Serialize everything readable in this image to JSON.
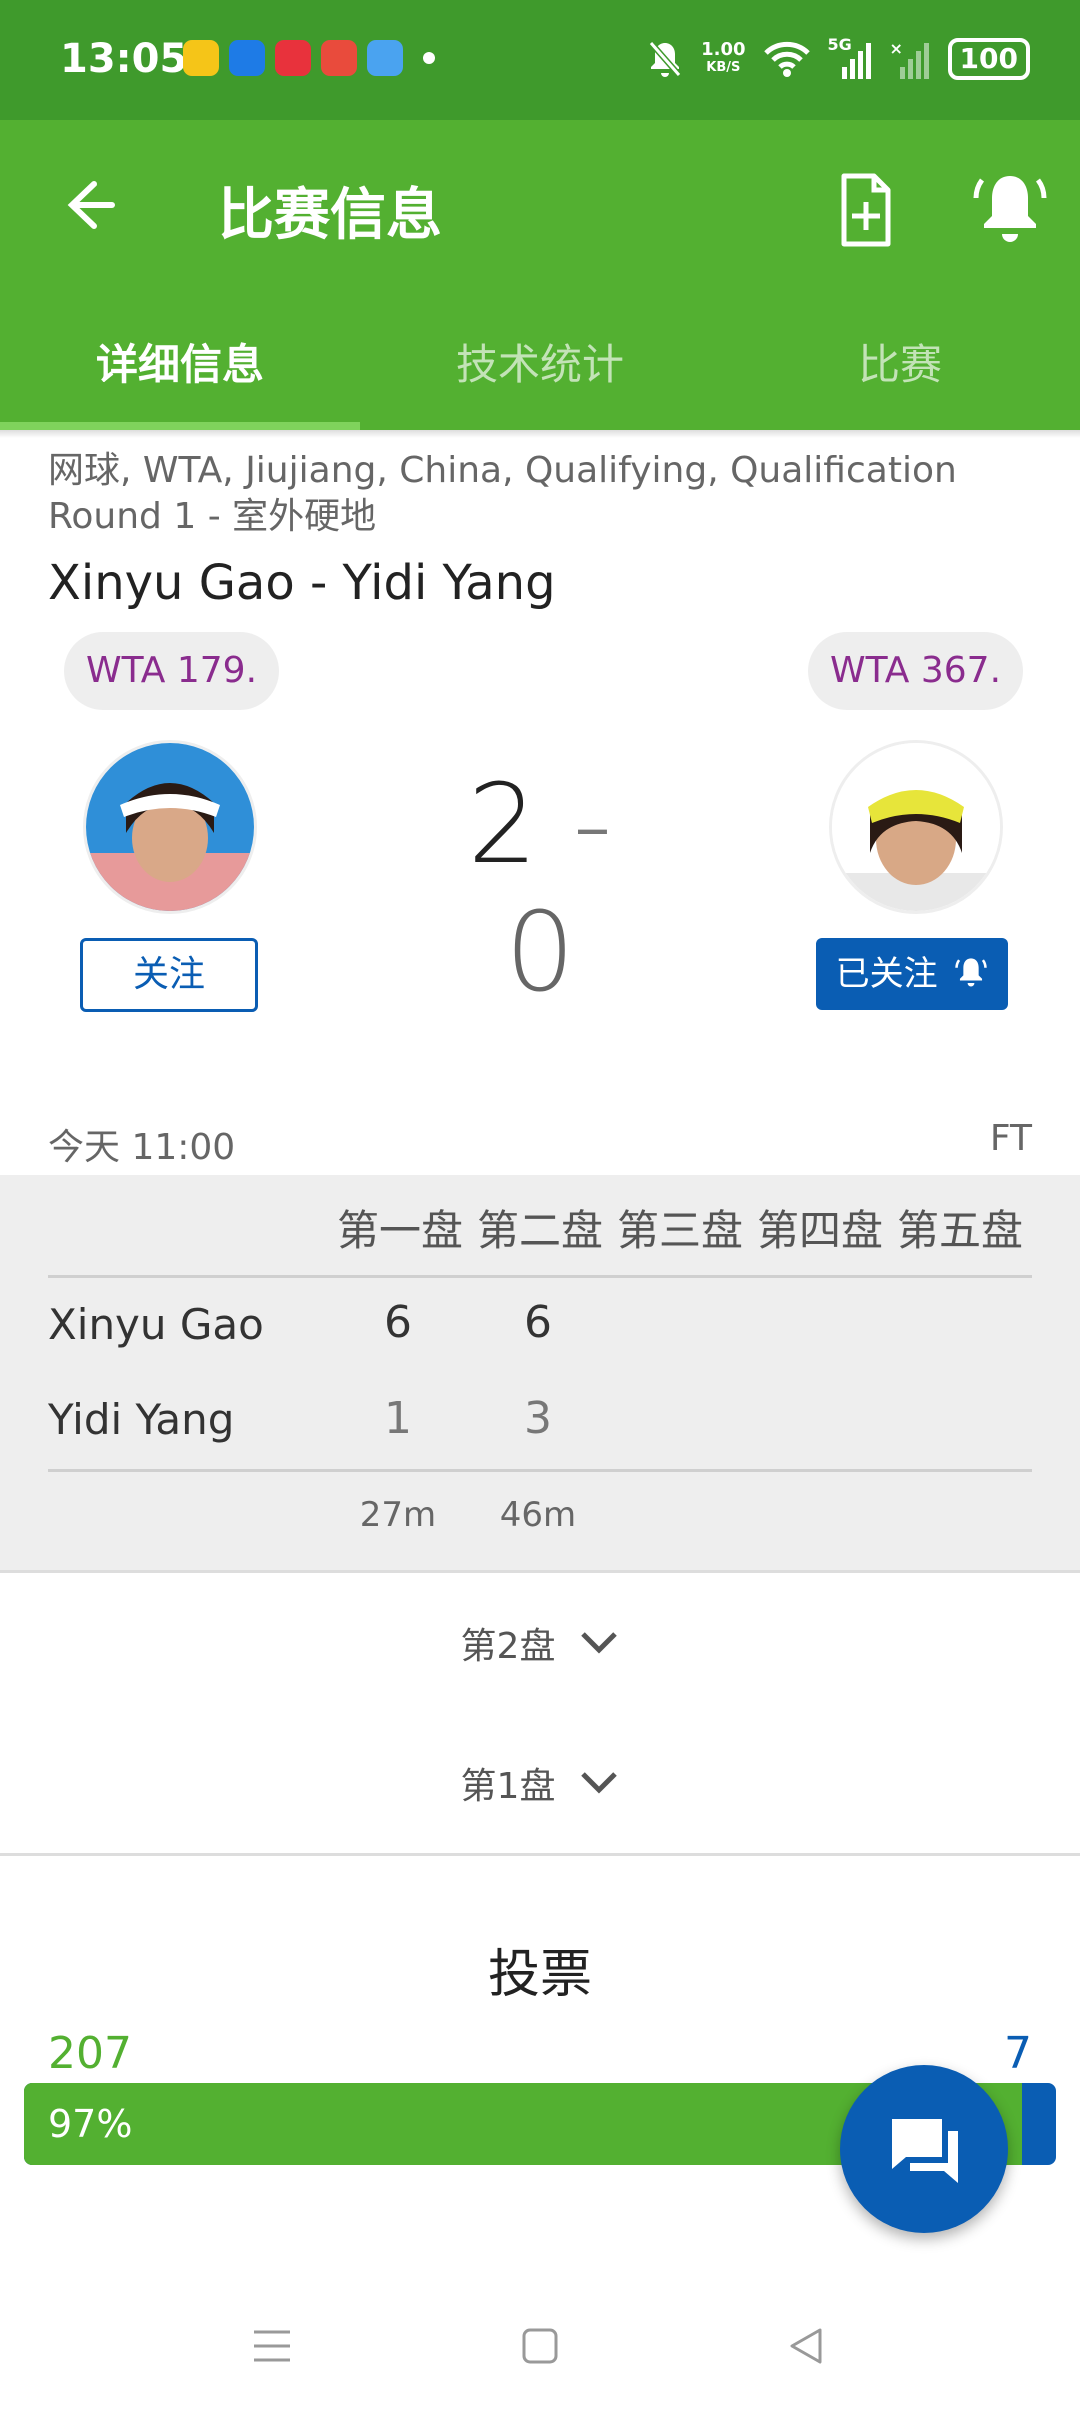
{
  "status_bar": {
    "time": "13:05",
    "network_speed_value": "1.00",
    "network_speed_unit": "KB/S",
    "signal_label": "5G",
    "battery": "100",
    "app_icons": [
      "weibo-icon",
      "qq-browser-icon",
      "xiaohongshu-icon",
      "toutiao-icon",
      "blue-app-icon"
    ]
  },
  "app_bar": {
    "title": "比赛信息"
  },
  "tabs": [
    {
      "label": "详细信息",
      "active": true
    },
    {
      "label": "技术统计",
      "active": false
    },
    {
      "label": "比赛",
      "active": false
    }
  ],
  "match": {
    "league": "网球, WTA, Jiujiang, China, Qualifying, Qualification Round 1 - 室外硬地",
    "title": "Xinyu Gao - Yidi Yang",
    "home_rank": "WTA 179.",
    "away_rank": "WTA 367.",
    "home_score": "2",
    "score_separator": "-",
    "away_score": "0",
    "follow_label": "关注",
    "followed_label": "已关注",
    "time": "今天 11:00",
    "status": "FT"
  },
  "sets_table": {
    "headers": [
      "第一盘",
      "第二盘",
      "第三盘",
      "第四盘",
      "第五盘"
    ],
    "rows": [
      {
        "player": "Xinyu Gao",
        "scores": [
          "6",
          "6"
        ]
      },
      {
        "player": "Yidi Yang",
        "scores": [
          "1",
          "3"
        ]
      }
    ],
    "durations": [
      "27m",
      "46m"
    ]
  },
  "set_details": [
    {
      "label": "第2盘"
    },
    {
      "label": "第1盘"
    }
  ],
  "vote": {
    "title": "投票",
    "home_votes": "207",
    "away_votes": "7",
    "home_percent_label": "97%",
    "home_fraction": 0.967
  },
  "colors": {
    "status_bar": "#3f9a2c",
    "app_bar": "#53b031",
    "primary_blue": "#0a5db3",
    "rank_text": "#8a2c8e"
  }
}
